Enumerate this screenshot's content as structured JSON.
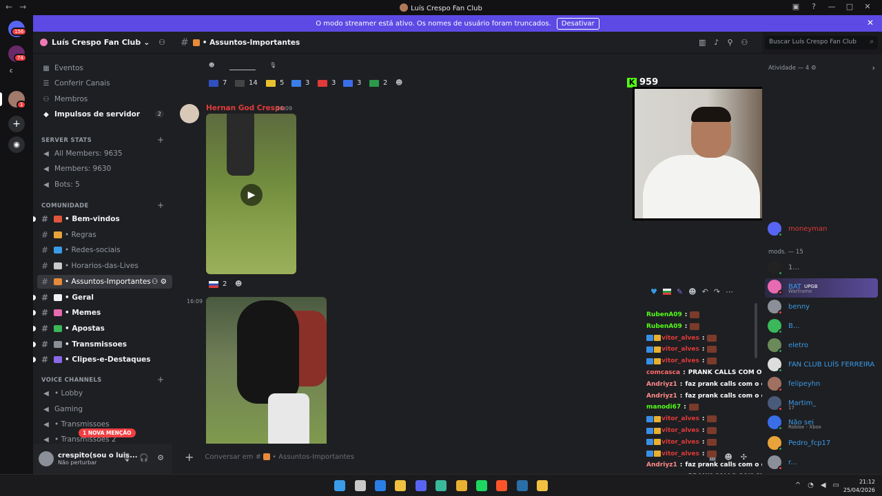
{
  "window": {
    "title": "Luís Crespo Fan Club"
  },
  "banner": {
    "text": "O modo streamer está ativo. Os nomes de usuário foram truncados.",
    "button": "Desativar"
  },
  "rail": {
    "badges": [
      "156",
      "74",
      "1"
    ],
    "mini_label": "c"
  },
  "server": {
    "name": "Luís Crespo Fan Club",
    "top_items": [
      {
        "label": "Eventos",
        "icon": "calendar-icon"
      },
      {
        "label": "Conferir Canais",
        "icon": "channels-icon"
      },
      {
        "label": "Membros",
        "icon": "members-icon"
      },
      {
        "label": "Impulsos de servidor",
        "icon": "boost-icon",
        "count": "2"
      }
    ],
    "categories": {
      "stats": "SERVER STATS",
      "comunidade": "COMUNIDADE",
      "voice": "VOICE CHANNELS"
    },
    "stats_channels": [
      "All Members: 9635",
      "Members: 9630",
      "Bots: 5"
    ],
    "text_channels": [
      {
        "label": "• Bem-vindos",
        "bold": true,
        "unread": true,
        "color": "#e0563a"
      },
      {
        "label": "• Regras",
        "bold": false,
        "color": "#e8a33a"
      },
      {
        "label": "• Redes-sociais",
        "bold": false,
        "color": "#3a9be8"
      },
      {
        "label": "• Horarios-das-Lives",
        "bold": false,
        "color": "#c9c9c9"
      },
      {
        "label": "• Assuntos-Importantes",
        "bold": false,
        "active": true,
        "color": "#e88a3a"
      },
      {
        "label": "• Geral",
        "bold": true,
        "unread": true,
        "color": "#f2f3f5"
      },
      {
        "label": "• Memes",
        "bold": true,
        "unread": true,
        "color": "#e86ab0"
      },
      {
        "label": "• Apostas",
        "bold": true,
        "unread": true,
        "color": "#3ab85a"
      },
      {
        "label": "• Transmissoes",
        "bold": true,
        "unread": true,
        "color": "#8a8f98"
      },
      {
        "label": "• Clipes-e-Destaques",
        "bold": true,
        "unread": true,
        "color": "#8a6ae8"
      }
    ],
    "voice_channels": [
      "• Lobby",
      "Gaming",
      "• Transmissoes",
      "• Transmissoes 2"
    ],
    "mention_pill": "1 NOVA MENÇÃO"
  },
  "user": {
    "name": "crespito(sou o luis...",
    "status": "Não perturbar"
  },
  "channel": {
    "name": "• Assuntos-Importantes",
    "search_placeholder": "Buscar Luís Crespo Fan Club"
  },
  "reactions_top": [
    {
      "count": "7",
      "color": "#3050c0"
    },
    {
      "count": "14",
      "color": "#444"
    },
    {
      "count": "5",
      "color": "#e8c030"
    },
    {
      "count": "3",
      "color": "#3a7ee8"
    },
    {
      "count": "3",
      "color": "#e03a3a"
    },
    {
      "count": "3",
      "color": "#3a6ee8"
    },
    {
      "count": "2",
      "color": "#2a9a4a"
    }
  ],
  "message": {
    "author": "Hernan God Crespo",
    "time": "16:09",
    "time2": "16:09",
    "reaction_count": "2"
  },
  "composer": {
    "placeholder": "Conversar em #",
    "channel": "• Assuntos-Importantes"
  },
  "kick": {
    "viewers": "959"
  },
  "chat_overlay": [
    {
      "user": "RubenA09",
      "color": "#53fc18",
      "text": "",
      "emote": true
    },
    {
      "user": "RubenA09",
      "color": "#53fc18",
      "text": "",
      "emote": true
    },
    {
      "user": "vitor_alves",
      "color": "#e03a3a",
      "text": "",
      "emote": true,
      "badges": true
    },
    {
      "user": "vitor_alves",
      "color": "#e03a3a",
      "text": "",
      "emote": true,
      "badges": true
    },
    {
      "user": "vitor_alves",
      "color": "#e03a3a",
      "text": "",
      "emote": true,
      "badges": true
    },
    {
      "user": "comcasca",
      "color": "#ff6b6b",
      "text": "PRANK CALLS COM O CIGANO"
    },
    {
      "user": "Andriyz1",
      "color": "#ff8a8a",
      "text": "faz prank calls com o cigano"
    },
    {
      "user": "Andriyz1",
      "color": "#ff8a8a",
      "text": "faz prank calls com o cigano"
    },
    {
      "user": "manodi67",
      "color": "#53fc18",
      "text": "",
      "emote": true
    },
    {
      "user": "vitor_alves",
      "color": "#e03a3a",
      "text": "",
      "emote": true,
      "badges": true
    },
    {
      "user": "vitor_alves",
      "color": "#e03a3a",
      "text": "",
      "emote": true,
      "badges": true
    },
    {
      "user": "vitor_alves",
      "color": "#e03a3a",
      "text": "",
      "emote": true,
      "badges": true
    },
    {
      "user": "vitor_alves",
      "color": "#e03a3a",
      "text": "",
      "emote": true,
      "badges": true
    },
    {
      "user": "Andriyz1",
      "color": "#ff8a8a",
      "text": "faz prank calls com o cigano"
    },
    {
      "user": "comcasca",
      "color": "#ff6b6b",
      "text": "PRANK CALLS COK CIGANO"
    }
  ],
  "members": {
    "activity": "Atividade — 4",
    "mods_header": "mods. — 15",
    "top_member": {
      "name": "moneyman",
      "color": "#e03a3a"
    },
    "list": [
      {
        "name": "1...",
        "color": "#949ba4",
        "avatar": "#222",
        "status": "#23a55a"
      },
      {
        "name": "BAT",
        "color": "#3a9be8",
        "avatar": "#e86ab0",
        "status": "#f23f43",
        "tag": "UPGB",
        "sub": "Warframe"
      },
      {
        "name": "benny",
        "color": "#3a9be8",
        "avatar": "#8a8f98",
        "status": "#f23f43"
      },
      {
        "name": "B...",
        "color": "#3a9be8",
        "avatar": "#3ab85a",
        "status": "#23a55a"
      },
      {
        "name": "eletro",
        "color": "#3a9be8",
        "avatar": "#6a8a5a",
        "status": "#23a55a"
      },
      {
        "name": "FAN CLUB LUÍS FERREIRA",
        "color": "#3a9be8",
        "avatar": "#ddd",
        "status": "#23a55a"
      },
      {
        "name": "felipeyhn",
        "color": "#3a9be8",
        "avatar": "#a07060",
        "status": "#f23f43"
      },
      {
        "name": "Martim_",
        "color": "#3a9be8",
        "avatar": "#4a5a7a",
        "status": "#f23f43",
        "sub": "17"
      },
      {
        "name": "Não sei",
        "color": "#3a9be8",
        "avatar": "#3a6ee8",
        "status": "#23a55a",
        "sub": "Roblox - Xbox"
      },
      {
        "name": "Pedro_fcp17",
        "color": "#3a9be8",
        "avatar": "#e8a33a",
        "status": "#23a55a"
      },
      {
        "name": "r...",
        "color": "#3a9be8",
        "avatar": "#8a8f98",
        "status": "#f23f43"
      }
    ]
  },
  "taskbar": {
    "apps": [
      {
        "name": "windows-start-icon",
        "color": "#3a9be8"
      },
      {
        "name": "search-taskbar-icon",
        "color": "#c9c9c9"
      },
      {
        "name": "edge-icon",
        "color": "#2a7ee8"
      },
      {
        "name": "folder-icon",
        "color": "#f0c040"
      },
      {
        "name": "discord-icon",
        "color": "#5865f2"
      },
      {
        "name": "app-green-icon",
        "color": "#3ab89a"
      },
      {
        "name": "chrome-icon",
        "color": "#e8b030"
      },
      {
        "name": "spotify-icon",
        "color": "#1ed760"
      },
      {
        "name": "brave-icon",
        "color": "#fb542b"
      },
      {
        "name": "steam-icon",
        "color": "#2a6ea8"
      },
      {
        "name": "app-yellow-icon",
        "color": "#f0c040"
      }
    ],
    "time": "21:12",
    "date": "25/04/2026"
  }
}
